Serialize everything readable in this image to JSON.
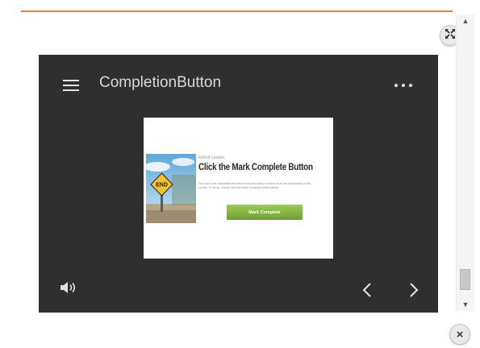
{
  "colors": {
    "accent": "#e8803e",
    "player_background": "#2f2f2f",
    "slide_button": "#7fae3f"
  },
  "icons": {
    "expand": "expand-arrows-icon",
    "close": "close-icon",
    "menu": "hamburger-menu-icon",
    "more": "more-dots-icon",
    "volume": "volume-icon",
    "previous": "chevron-left-icon",
    "next": "chevron-right-icon",
    "scroll_up": "scroll-up-arrow-icon",
    "scroll_down": "scroll-down-arrow-icon"
  },
  "player": {
    "title": "CompletionButton"
  },
  "slide": {
    "eyebrow": "End of Lesson",
    "heading": "Click the Mark Complete Button",
    "body": "You have now completed this lesson and are ready to move on to the next lesson in the course. To do so, simply click the Mark Complete button below.",
    "button_label": "Mark Complete",
    "sign_text": "END"
  }
}
